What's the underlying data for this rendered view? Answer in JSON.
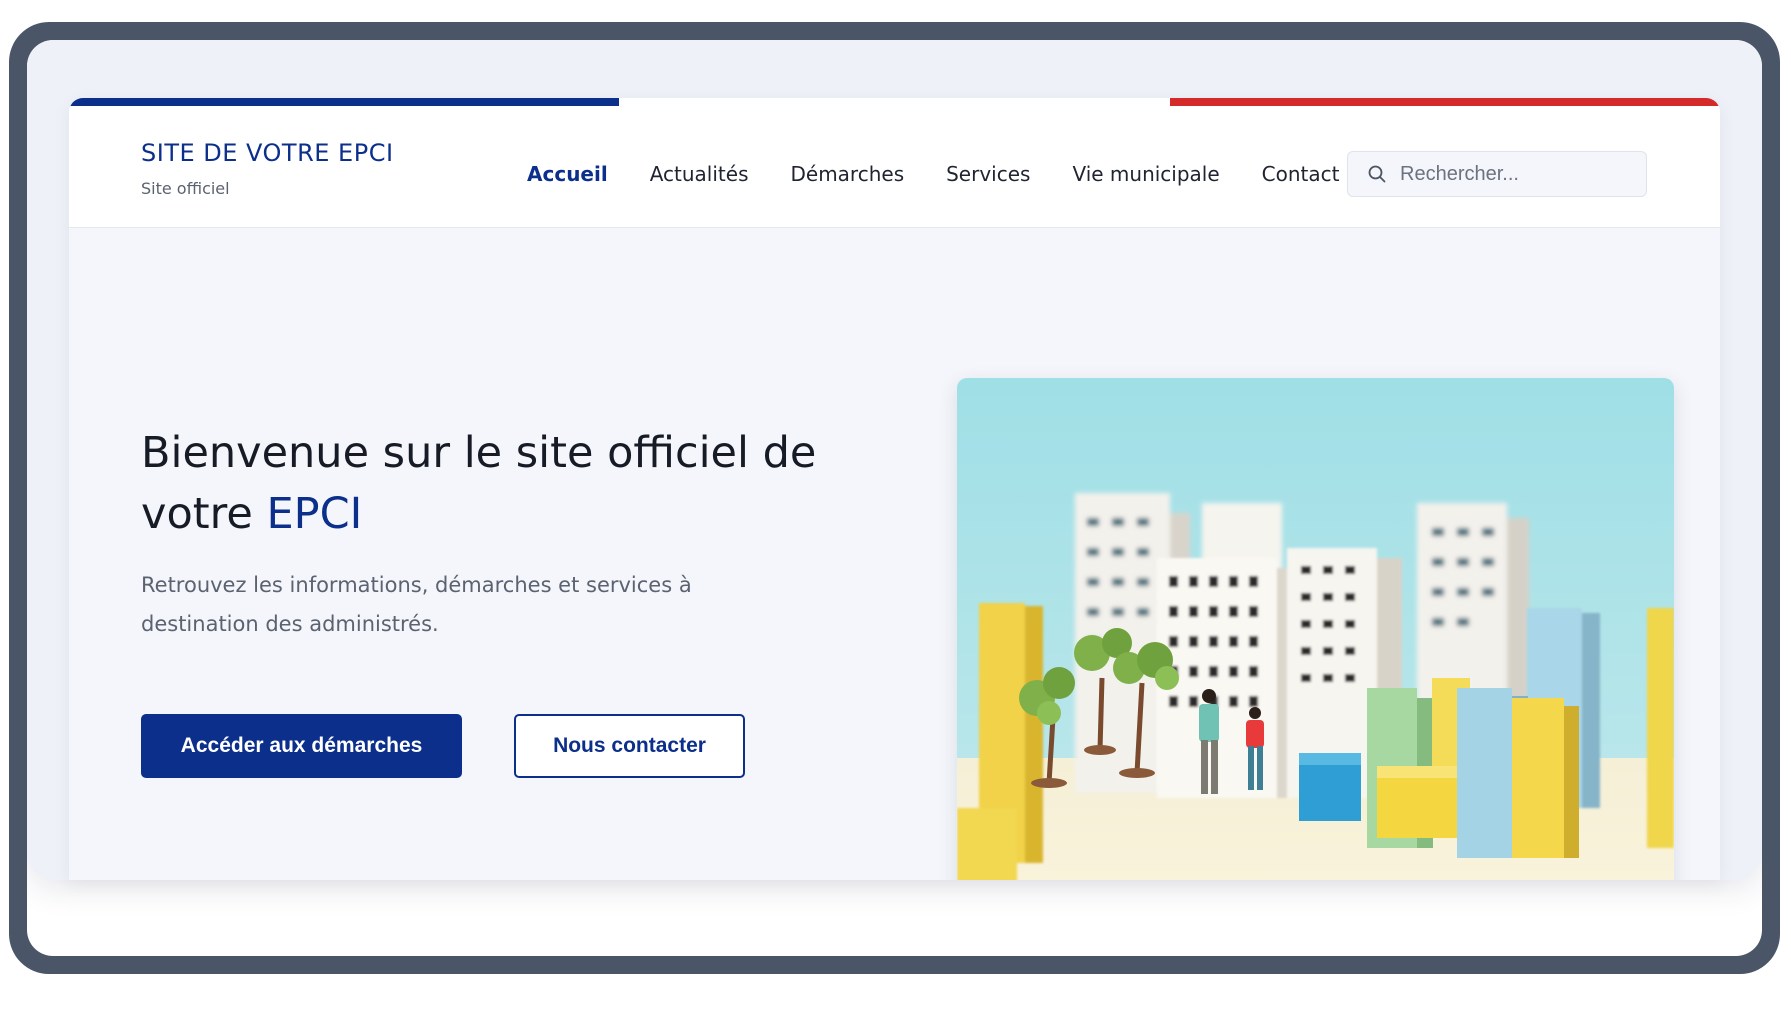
{
  "brand": {
    "title": "SITE DE VOTRE EPCI",
    "subtitle": "Site officiel"
  },
  "nav": {
    "items": [
      {
        "label": "Accueil",
        "active": true
      },
      {
        "label": "Actualités",
        "active": false
      },
      {
        "label": "Démarches",
        "active": false
      },
      {
        "label": "Services",
        "active": false
      },
      {
        "label": "Vie municipale",
        "active": false
      },
      {
        "label": "Contact",
        "active": false
      }
    ]
  },
  "search": {
    "placeholder": "Rechercher..."
  },
  "hero": {
    "title_part1": "Bienvenue sur le site officiel de votre ",
    "title_accent": "EPCI",
    "description": "Retrouvez les informations, démarches et services à destination des administrés.",
    "primary_button": "Accéder aux démarches",
    "secondary_button": "Nous contacter"
  },
  "colors": {
    "primary": "#0b2f8a",
    "accent_red": "#d42a2a",
    "text_dark": "#171b26",
    "text_muted": "#5b6270",
    "background": "#f4f6fb",
    "frame": "#4a5568"
  },
  "icons": {
    "search": "search-icon",
    "hero_image": "city-blocks-illustration"
  }
}
